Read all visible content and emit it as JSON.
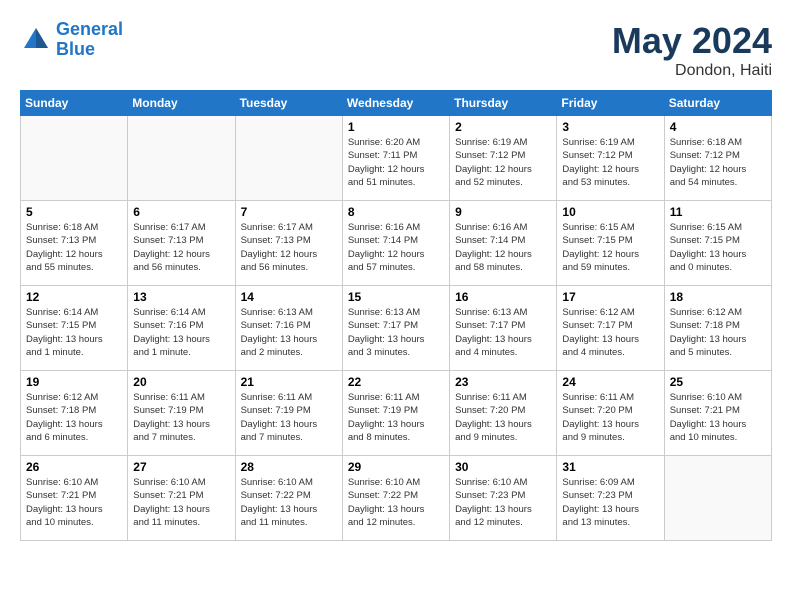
{
  "header": {
    "logo_line1": "General",
    "logo_line2": "Blue",
    "month_year": "May 2024",
    "location": "Dondon, Haiti"
  },
  "weekdays": [
    "Sunday",
    "Monday",
    "Tuesday",
    "Wednesday",
    "Thursday",
    "Friday",
    "Saturday"
  ],
  "weeks": [
    [
      {
        "day": "",
        "info": ""
      },
      {
        "day": "",
        "info": ""
      },
      {
        "day": "",
        "info": ""
      },
      {
        "day": "1",
        "info": "Sunrise: 6:20 AM\nSunset: 7:11 PM\nDaylight: 12 hours\nand 51 minutes."
      },
      {
        "day": "2",
        "info": "Sunrise: 6:19 AM\nSunset: 7:12 PM\nDaylight: 12 hours\nand 52 minutes."
      },
      {
        "day": "3",
        "info": "Sunrise: 6:19 AM\nSunset: 7:12 PM\nDaylight: 12 hours\nand 53 minutes."
      },
      {
        "day": "4",
        "info": "Sunrise: 6:18 AM\nSunset: 7:12 PM\nDaylight: 12 hours\nand 54 minutes."
      }
    ],
    [
      {
        "day": "5",
        "info": "Sunrise: 6:18 AM\nSunset: 7:13 PM\nDaylight: 12 hours\nand 55 minutes."
      },
      {
        "day": "6",
        "info": "Sunrise: 6:17 AM\nSunset: 7:13 PM\nDaylight: 12 hours\nand 56 minutes."
      },
      {
        "day": "7",
        "info": "Sunrise: 6:17 AM\nSunset: 7:13 PM\nDaylight: 12 hours\nand 56 minutes."
      },
      {
        "day": "8",
        "info": "Sunrise: 6:16 AM\nSunset: 7:14 PM\nDaylight: 12 hours\nand 57 minutes."
      },
      {
        "day": "9",
        "info": "Sunrise: 6:16 AM\nSunset: 7:14 PM\nDaylight: 12 hours\nand 58 minutes."
      },
      {
        "day": "10",
        "info": "Sunrise: 6:15 AM\nSunset: 7:15 PM\nDaylight: 12 hours\nand 59 minutes."
      },
      {
        "day": "11",
        "info": "Sunrise: 6:15 AM\nSunset: 7:15 PM\nDaylight: 13 hours\nand 0 minutes."
      }
    ],
    [
      {
        "day": "12",
        "info": "Sunrise: 6:14 AM\nSunset: 7:15 PM\nDaylight: 13 hours\nand 1 minute."
      },
      {
        "day": "13",
        "info": "Sunrise: 6:14 AM\nSunset: 7:16 PM\nDaylight: 13 hours\nand 1 minute."
      },
      {
        "day": "14",
        "info": "Sunrise: 6:13 AM\nSunset: 7:16 PM\nDaylight: 13 hours\nand 2 minutes."
      },
      {
        "day": "15",
        "info": "Sunrise: 6:13 AM\nSunset: 7:17 PM\nDaylight: 13 hours\nand 3 minutes."
      },
      {
        "day": "16",
        "info": "Sunrise: 6:13 AM\nSunset: 7:17 PM\nDaylight: 13 hours\nand 4 minutes."
      },
      {
        "day": "17",
        "info": "Sunrise: 6:12 AM\nSunset: 7:17 PM\nDaylight: 13 hours\nand 4 minutes."
      },
      {
        "day": "18",
        "info": "Sunrise: 6:12 AM\nSunset: 7:18 PM\nDaylight: 13 hours\nand 5 minutes."
      }
    ],
    [
      {
        "day": "19",
        "info": "Sunrise: 6:12 AM\nSunset: 7:18 PM\nDaylight: 13 hours\nand 6 minutes."
      },
      {
        "day": "20",
        "info": "Sunrise: 6:11 AM\nSunset: 7:19 PM\nDaylight: 13 hours\nand 7 minutes."
      },
      {
        "day": "21",
        "info": "Sunrise: 6:11 AM\nSunset: 7:19 PM\nDaylight: 13 hours\nand 7 minutes."
      },
      {
        "day": "22",
        "info": "Sunrise: 6:11 AM\nSunset: 7:19 PM\nDaylight: 13 hours\nand 8 minutes."
      },
      {
        "day": "23",
        "info": "Sunrise: 6:11 AM\nSunset: 7:20 PM\nDaylight: 13 hours\nand 9 minutes."
      },
      {
        "day": "24",
        "info": "Sunrise: 6:11 AM\nSunset: 7:20 PM\nDaylight: 13 hours\nand 9 minutes."
      },
      {
        "day": "25",
        "info": "Sunrise: 6:10 AM\nSunset: 7:21 PM\nDaylight: 13 hours\nand 10 minutes."
      }
    ],
    [
      {
        "day": "26",
        "info": "Sunrise: 6:10 AM\nSunset: 7:21 PM\nDaylight: 13 hours\nand 10 minutes."
      },
      {
        "day": "27",
        "info": "Sunrise: 6:10 AM\nSunset: 7:21 PM\nDaylight: 13 hours\nand 11 minutes."
      },
      {
        "day": "28",
        "info": "Sunrise: 6:10 AM\nSunset: 7:22 PM\nDaylight: 13 hours\nand 11 minutes."
      },
      {
        "day": "29",
        "info": "Sunrise: 6:10 AM\nSunset: 7:22 PM\nDaylight: 13 hours\nand 12 minutes."
      },
      {
        "day": "30",
        "info": "Sunrise: 6:10 AM\nSunset: 7:23 PM\nDaylight: 13 hours\nand 12 minutes."
      },
      {
        "day": "31",
        "info": "Sunrise: 6:09 AM\nSunset: 7:23 PM\nDaylight: 13 hours\nand 13 minutes."
      },
      {
        "day": "",
        "info": ""
      }
    ]
  ]
}
